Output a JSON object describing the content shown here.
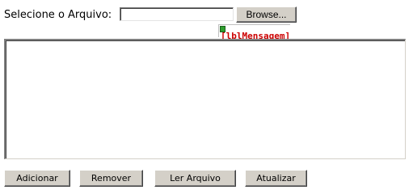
{
  "file_picker": {
    "label": "Selecione o Arquivo:",
    "value": "",
    "browse_label": "Browse..."
  },
  "message_label": {
    "text": "[lblMensagem]",
    "icon": "broken-image-icon",
    "color": "#cc0000"
  },
  "content_area": {
    "value": ""
  },
  "actions": {
    "adicionar": "Adicionar",
    "remover": "Remover",
    "ler_arquivo": "Ler Arquivo",
    "atualizar": "Atualizar"
  }
}
